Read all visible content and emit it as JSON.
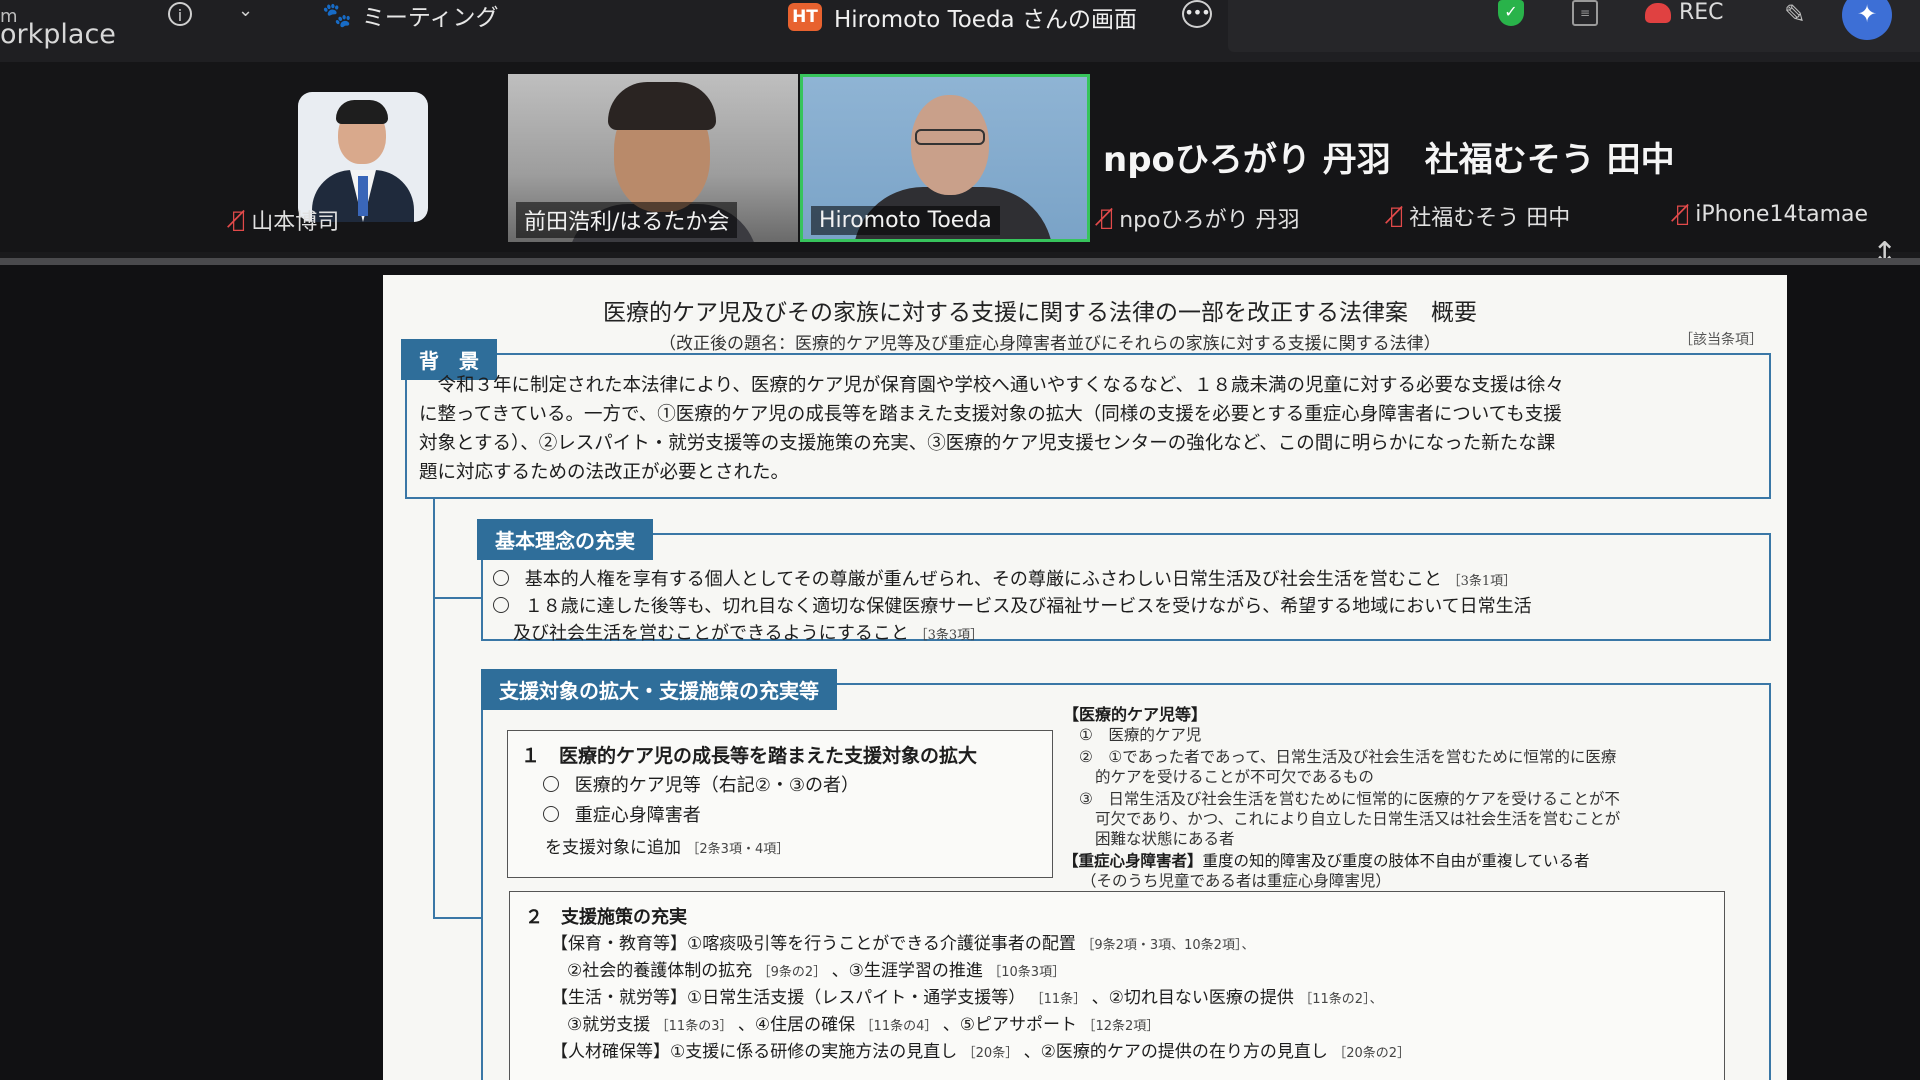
{
  "topbar": {
    "app_title_top": "m",
    "app_title": "orkplace",
    "meeting_label": "ミーティング",
    "share_badge": "HT",
    "share_label": "Hiromoto Toeda さんの画面",
    "rec_label": "REC"
  },
  "participants": {
    "p1_name": "山本博司",
    "p2_name": "前田浩利/はるたか会",
    "p3_name": "Hiromoto Toeda",
    "p4_name": "npoひろがり 丹羽",
    "p5_name": "社福むそう 田中",
    "p6_name": "iPhone14tamae",
    "big_caption": "npoひろがり 丹羽　社福むそう 田中"
  },
  "doc": {
    "title": "医療的ケア児及びその家族に対する支援に関する法律の一部を改正する法律案　概要",
    "subtitle": "（改正後の題名：医療的ケア児等及び重症心身障害者並びにそれらの家族に対する支援に関する法律）",
    "ref": "［該当条項］",
    "bg_head": "背　景",
    "bg_lines": [
      "　令和３年に制定された本法律により、医療的ケア児が保育園や学校へ通いやすくなるなど、１８歳未満の児童に対する必要な支援は徐々",
      "に整ってきている。一方で、①医療的ケア児の成長等を踏まえた支援対象の拡大（同様の支援を必要とする重症心身障害者についても支援",
      "対象とする）、②レスパイト・就労支援等の支援施策の充実、③医療的ケア児支援センターの強化など、この間に明らかになった新たな課",
      "題に対応するための法改正が必要とされた。"
    ],
    "basic_head": "基本理念の充実",
    "basic_1": "基本的人権を享有する個人としてその尊厳が重んぜられ、その尊厳にふさわしい日常生活及び社会生活を営むこと",
    "basic_1_ref": "［3条1項］",
    "basic_2": "１８歳に達した後等も、切れ目なく適切な保健医療サービス及び福祉サービスを受けながら、希望する地域において日常生活",
    "basic_2b": "及び社会生活を営むことができるようにすること",
    "basic_2_ref": "［3条3項］",
    "support_head": "支援対象の拡大・支援施策の充実等",
    "s1_title": "１　医療的ケア児の成長等を踏まえた支援対象の拡大",
    "s1_item1": "医療的ケア児等（右記②・③の者）",
    "s1_item2": "重症心身障害者",
    "s1_add": "を支援対象に追加",
    "s1_add_ref": "［2条3項・4項］",
    "def_head": "【医療的ケア児等】",
    "def_1": "①　医療的ケア児",
    "def_2a": "②　①であった者であって、日常生活及び社会生活を営むために恒常的に医療",
    "def_2b": "的ケアを受けることが不可欠であるもの",
    "def_3a": "③　日常生活及び社会生活を営むために恒常的に医療的ケアを受けることが不",
    "def_3b": "可欠であり、かつ、これにより自立した日常生活又は社会生活を営むことが",
    "def_3c": "困難な状態にある者",
    "def_sev_head": "【重症心身障害者】",
    "def_sev": "重度の知的障害及び重度の肢体不自由が重複している者",
    "def_sev_note": "（そのうち児童である者は重症心身障害児）",
    "s2_title": "２　支援施策の充実",
    "s2_l1": "【保育・教育等】①喀痰吸引等を行うことができる介護従事者の配置",
    "s2_l1_ref": "［9条2項・3項、10条2項］、",
    "s2_l2": "②社会的養護体制の拡充",
    "s2_l2_ref": "［9条の2］",
    "s2_l2b": "、③生涯学習の推進",
    "s2_l2b_ref": "［10条3項］",
    "s2_l3": "【生活・就労等】①日常生活支援（レスパイト・通学支援等）",
    "s2_l3_ref": "［11条］",
    "s2_l3b": "、②切れ目ない医療の提供",
    "s2_l3b_ref": "［11条の2］、",
    "s2_l4": "③就労支援",
    "s2_l4_ref": "［11条の3］",
    "s2_l4b": "、④住居の確保",
    "s2_l4b_ref": "［11条の4］",
    "s2_l4c": "、⑤ピアサポート",
    "s2_l4c_ref": "［12条2項］",
    "s2_l5": "【人材確保等】①支援に係る研修の実施方法の見直し",
    "s2_l5_ref": "［20条］",
    "s2_l5b": "、②医療的ケアの提供の在り方の見直し",
    "s2_l5b_ref": "［20条の2］"
  }
}
